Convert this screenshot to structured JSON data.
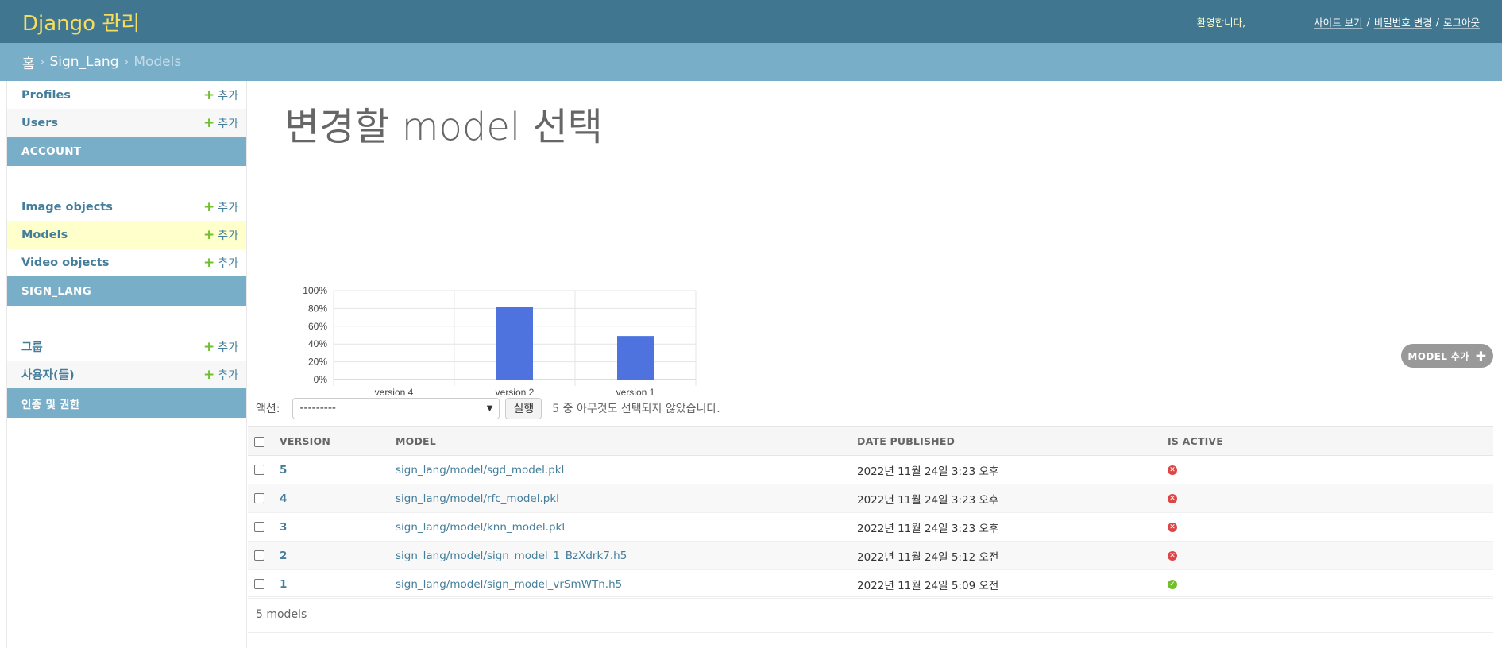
{
  "header": {
    "branding": "Django 관리",
    "welcome": "환영합니다,",
    "links": {
      "view_site": "사이트 보기",
      "change_password": "비밀번호 변경",
      "logout": "로그아웃"
    },
    "separator": "/"
  },
  "breadcrumbs": {
    "home": "홈",
    "app": "Sign_Lang",
    "current": "Models",
    "separator": "›"
  },
  "sidebar": {
    "add_label": "추가",
    "groups": [
      {
        "caption": "ACCOUNT",
        "models": [
          "Profiles",
          "Users"
        ]
      },
      {
        "caption": "SIGN_LANG",
        "models": [
          "Image objects",
          "Models",
          "Video objects"
        ],
        "current": "Models"
      },
      {
        "caption": "인증 및 권한",
        "models": [
          "그룹",
          "사용자(들)"
        ]
      }
    ]
  },
  "page_title": "변경할 model 선택",
  "add_button": "MODEL 추가",
  "actions": {
    "label": "액션:",
    "selected_option": "---------",
    "go": "실행",
    "counter": "5 중 아무것도 선택되지 않았습니다."
  },
  "table": {
    "headers": [
      "VERSION",
      "MODEL",
      "DATE PUBLISHED",
      "IS ACTIVE"
    ],
    "rows": [
      {
        "version": "5",
        "model": "sign_lang/model/sgd_model.pkl",
        "date": "2022년 11월 24일 3:23 오후",
        "active": false
      },
      {
        "version": "4",
        "model": "sign_lang/model/rfc_model.pkl",
        "date": "2022년 11월 24일 3:23 오후",
        "active": false
      },
      {
        "version": "3",
        "model": "sign_lang/model/knn_model.pkl",
        "date": "2022년 11월 24일 3:23 오후",
        "active": false
      },
      {
        "version": "2",
        "model": "sign_lang/model/sign_model_1_BzXdrk7.h5",
        "date": "2022년 11월 24일 5:12 오전",
        "active": false
      },
      {
        "version": "1",
        "model": "sign_lang/model/sign_model_vrSmWTn.h5",
        "date": "2022년 11월 24일 5:09 오전",
        "active": true
      }
    ]
  },
  "paginator": "5 models",
  "colors": {
    "header": "#417690",
    "breadcrumbs": "#79aec8",
    "branding": "#f5dd5d",
    "link": "#447e9b",
    "bar": "#4e73df",
    "add": "#70bf2b",
    "no": "#dd4646"
  },
  "chart_data": {
    "type": "bar",
    "categories": [
      "version 4",
      "version 2",
      "version 1"
    ],
    "values": [
      0,
      82,
      49
    ],
    "ylim": [
      0,
      100
    ],
    "yticks": [
      "0%",
      "20%",
      "40%",
      "60%",
      "80%",
      "100%"
    ],
    "grid": true,
    "bar_color": "#4e73df",
    "title": "",
    "xlabel": "",
    "ylabel": ""
  }
}
